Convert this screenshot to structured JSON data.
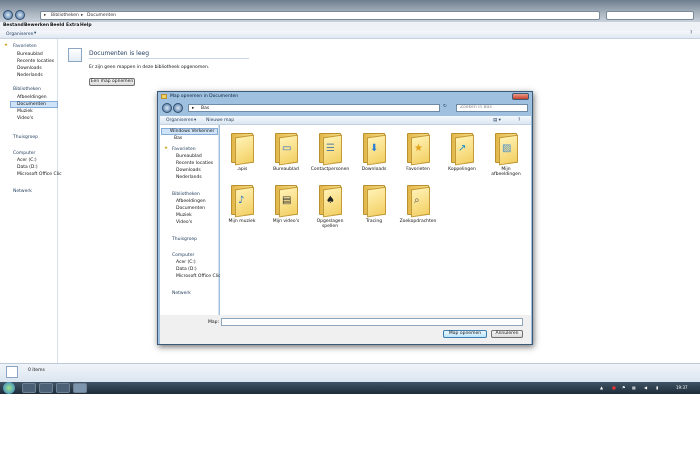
{
  "explorer": {
    "address": [
      "Bibliotheken",
      "Documenten"
    ],
    "menu": [
      "Bestand",
      "Bewerken",
      "Beeld",
      "Extra",
      "Help"
    ],
    "organize_label": "Organiseren",
    "nav": {
      "favorites_header": "Favorieten",
      "favorites": [
        "Bureaublad",
        "Recente locaties",
        "Downloads",
        "Nederlands"
      ],
      "libraries_header": "Bibliotheken",
      "libraries": [
        "Afbeeldingen",
        "Documenten",
        "Muziek",
        "Video's"
      ],
      "homegroup": "Thuisgroep",
      "computer_header": "Computer",
      "computer": [
        "Acer (C:)",
        "Data (D:)",
        "Microsoft Office Clic"
      ],
      "network": "Netwerk"
    },
    "empty_title": "Documenten is leeg",
    "empty_message": "Er zijn geen mappen in deze bibliotheek opgenomen.",
    "add_folder_button": "Een map opnemen",
    "status_items": "0 items"
  },
  "dialog": {
    "title": "Map opnemen in Documenten",
    "address": "Bas",
    "search_placeholder": "Zoeken in Bas",
    "organize_label": "Organiseren",
    "new_folder_label": "Nieuwe map",
    "nav": {
      "windows_drive": "Windows Verkenner",
      "user": "Bas",
      "favorites_header": "Favorieten",
      "favorites": [
        "Bureaublad",
        "Recente locaties",
        "Downloads",
        "Nederlands"
      ],
      "libraries_header": "Bibliotheken",
      "libraries": [
        "Afbeeldingen",
        "Documenten",
        "Muziek",
        "Video's"
      ],
      "homegroup": "Thuisgroep",
      "computer_header": "Computer",
      "computer": [
        "Acer (C:)",
        "Data (D:)",
        "Microsoft Office Clic"
      ],
      "network": "Netwerk"
    },
    "folders": [
      {
        "label": ".apis",
        "overlay": ""
      },
      {
        "label": "Bureaublad",
        "overlay": "desktop"
      },
      {
        "label": "Contactpersonen",
        "overlay": "contacts"
      },
      {
        "label": "Downloads",
        "overlay": "download"
      },
      {
        "label": "Favorieten",
        "overlay": "star"
      },
      {
        "label": "Koppelingen",
        "overlay": "link"
      },
      {
        "label": "Mijn afbeeldingen",
        "overlay": "picture"
      },
      {
        "label": "Mijn muziek",
        "overlay": "music"
      },
      {
        "label": "Mijn video's",
        "overlay": "film"
      },
      {
        "label": "Opgeslagen spellen",
        "overlay": "games"
      },
      {
        "label": "Tracing",
        "overlay": ""
      },
      {
        "label": "Zoekopdrachten",
        "overlay": "search"
      }
    ],
    "folder_label": "Map:",
    "folder_value": "",
    "ok_button": "Map opnemen",
    "cancel_button": "Annuleren"
  },
  "taskbar": {
    "clock": "19:37"
  },
  "colors": {
    "accent": "#3f6d9e",
    "taskbar": "#1e2c38",
    "dialog_frame": "#9fc1df"
  }
}
